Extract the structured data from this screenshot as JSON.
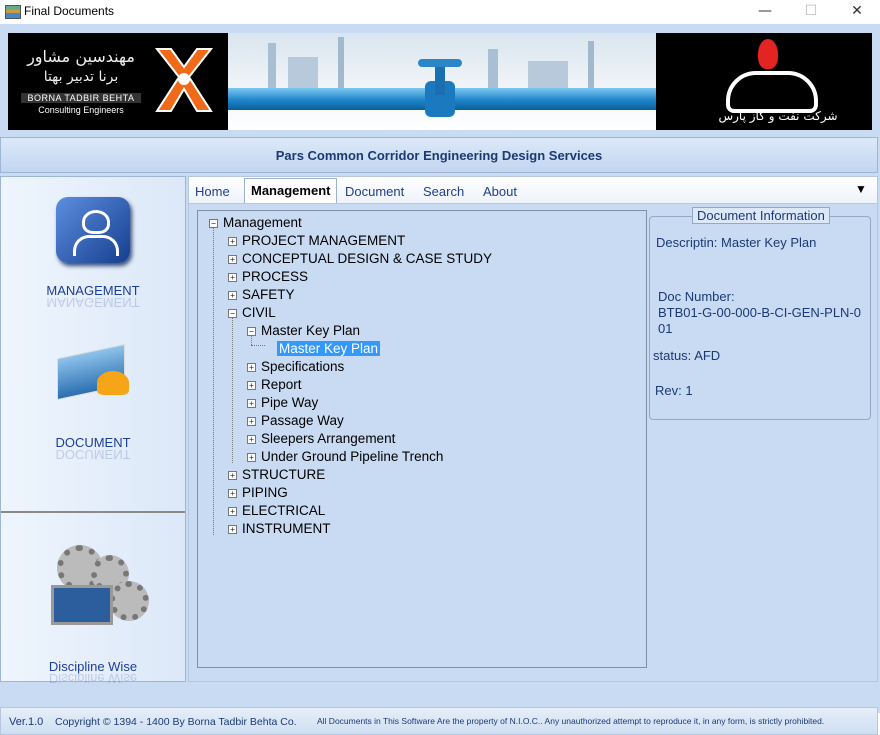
{
  "window": {
    "title": "Final Documents",
    "minimize": "—",
    "maximize": "☐",
    "close": "✕"
  },
  "banner": {
    "company_fa_line1": "مهندسین مشاور",
    "company_fa_line2": "برنا تدبیر بهتا",
    "company_en_line1": "BORNA TADBIR BEHTA",
    "company_en_line2": "Consulting Engineers",
    "client_fa": "شرکت نفت و گاز پارس"
  },
  "header": {
    "title": "Pars Common Corridor Engineering Design Services"
  },
  "sidebar": {
    "items": [
      {
        "label": "MANAGEMENT"
      },
      {
        "label": "DOCUMENT"
      },
      {
        "label": "Discipline Wise"
      }
    ]
  },
  "tabs": [
    {
      "label": "Home"
    },
    {
      "label": "Management"
    },
    {
      "label": "Document"
    },
    {
      "label": "Search"
    },
    {
      "label": "About"
    }
  ],
  "tree": {
    "root": "Management",
    "nodes": [
      "PROJECT MANAGEMENT",
      "CONCEPTUAL DESIGN & CASE STUDY",
      "PROCESS",
      "SAFETY",
      "CIVIL",
      "Master Key Plan",
      "Master Key Plan",
      "Specifications",
      "Report",
      "Pipe Way",
      "Passage Way",
      "Sleepers Arrangement",
      "Under Ground Pipeline Trench",
      "STRUCTURE",
      "PIPING",
      "ELECTRICAL",
      "INSTRUMENT"
    ]
  },
  "doc_info": {
    "title": "Document Information",
    "description": "Descriptin: Master Key Plan",
    "doc_number_label": "Doc Number:",
    "doc_number_line1": "BTB01-G-00-000-B-CI-GEN-PLN-0",
    "doc_number_line2": "01",
    "status": "status: AFD",
    "rev": "Rev: 1"
  },
  "footer": {
    "version": "Ver.1.0",
    "copyright": "Copyright © 1394 - 1400  By  Borna Tadbir Behta Co.",
    "notice": "All Documents in This Software Are the property of N.I.O.C.. Any unauthorized attempt to reproduce it, in any form, is strictly prohibited."
  },
  "colors": {
    "accent": "#1d3e9a",
    "selection": "#3399ff",
    "panel": "#c9daf3"
  }
}
